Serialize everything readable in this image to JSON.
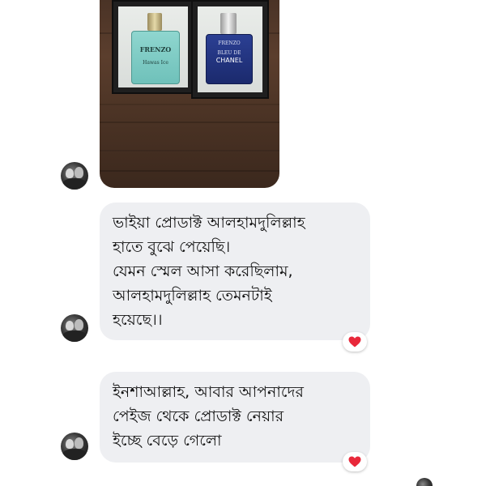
{
  "photo": {
    "left_bottle": {
      "brand": "FRENZO",
      "name": "Hawas Ice"
    },
    "right_bottle": {
      "brand": "FRENZO",
      "line1": "BLEU DE",
      "line2": "CHANEL"
    }
  },
  "messages": [
    {
      "lines": [
        "ভাইয়া প্রোডাক্ট আলহামদুলিল্লাহ",
        "হাতে বুঝে পেয়েছি।",
        "যেমন স্মেল আসা করেছিলাম,",
        "আলহামদুলিল্লাহ তেমনটাই",
        "হয়েছে।।"
      ],
      "reaction": "heart-icon"
    },
    {
      "lines": [
        "ইনশাআল্লাহ, আবার আপনাদের",
        "পেইজ থেকে প্রোডাক্ট নেয়ার",
        "ইচ্ছে বেড়ে গেলো"
      ],
      "reaction": "heart-icon"
    }
  ],
  "colors": {
    "bubble_bg": "#eeeff2",
    "heart": "#e8283a"
  }
}
